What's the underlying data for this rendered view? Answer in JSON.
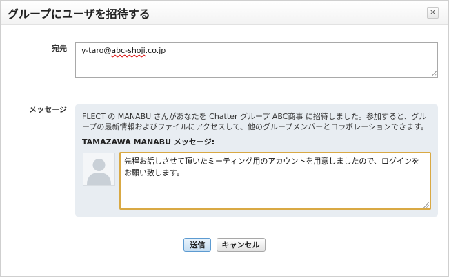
{
  "dialog": {
    "title": "グループにユーザを招待する",
    "close_label": "×"
  },
  "to": {
    "label": "宛先",
    "value_prefix": "y-taro@",
    "value_domain": "abc-shoji",
    "value_suffix": ".co.jp"
  },
  "message": {
    "label": "メッセージ",
    "invite_text": "FLECT の MANABU さんがあなたを Chatter グループ ABC商事 に招待しました。参加すると、グループの最新情報およびファイルにアクセスして、他のグループメンバーとコラボレーションできます。",
    "sender_heading": "TAMAZAWA MANABU メッセージ:",
    "body": "先程お話しさせて頂いたミーティング用のアカウントを用意しましたので、ログインをお願い致します。"
  },
  "buttons": {
    "send": "送信",
    "cancel": "キャンセル"
  },
  "icons": [
    "close-icon",
    "avatar-placeholder-icon",
    "resize-grip-icon"
  ]
}
